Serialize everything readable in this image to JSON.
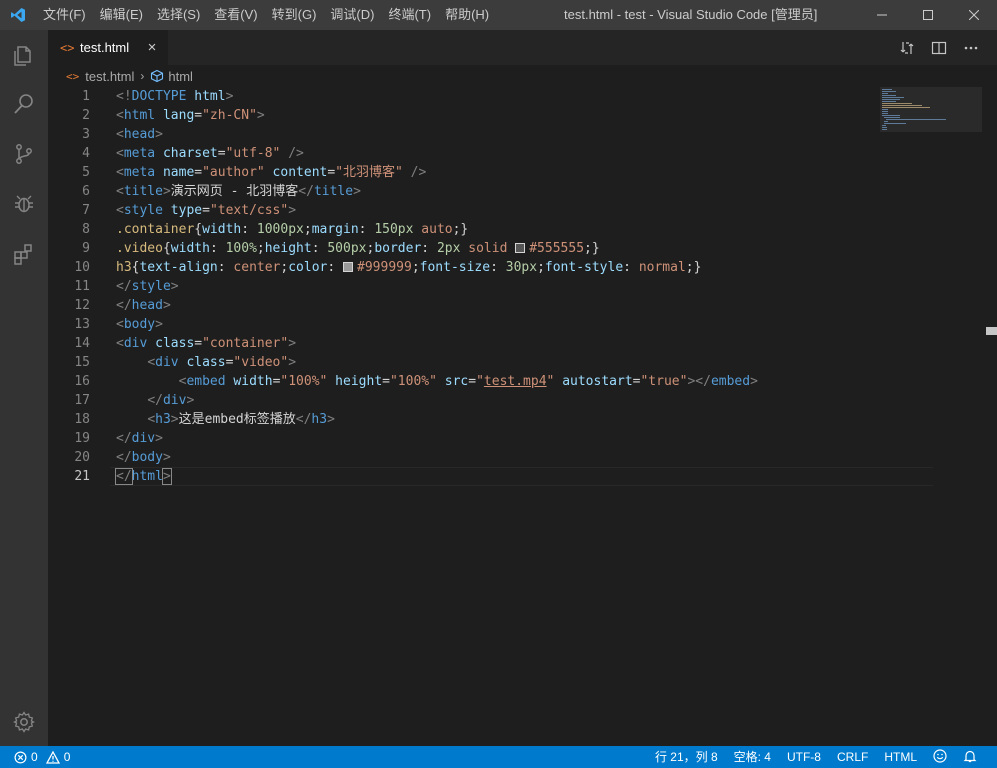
{
  "titlebar": {
    "menus": [
      "文件(F)",
      "编辑(E)",
      "选择(S)",
      "查看(V)",
      "转到(G)",
      "调试(D)",
      "终端(T)",
      "帮助(H)"
    ],
    "title": "test.html - test - Visual Studio Code [管理员]"
  },
  "activitybar": {
    "items": [
      "explorer-icon",
      "search-icon",
      "source-control-icon",
      "debug-icon",
      "extensions-icon"
    ],
    "bottom": "manage-gear-icon"
  },
  "tab": {
    "icon_text": "<>",
    "label": "test.html",
    "close": "×"
  },
  "breadcrumb": {
    "file": "test.html",
    "symbol": "html"
  },
  "line_numbers": [
    "1",
    "2",
    "3",
    "4",
    "5",
    "6",
    "7",
    "8",
    "9",
    "10",
    "11",
    "12",
    "13",
    "14",
    "15",
    "16",
    "17",
    "18",
    "19",
    "20",
    "21"
  ],
  "active_line": "21",
  "code": {
    "l1": [
      "<!",
      "DOCTYPE",
      " html",
      ">"
    ],
    "l2": [
      "<",
      "html",
      " lang",
      "=",
      "\"zh-CN\"",
      ">"
    ],
    "l3": [
      "<",
      "head",
      ">"
    ],
    "l4": [
      "<",
      "meta",
      " charset",
      "=",
      "\"utf-8\"",
      " />"
    ],
    "l5": [
      "<",
      "meta",
      " name",
      "=",
      "\"author\"",
      " content",
      "=",
      "\"北羽博客\"",
      " />"
    ],
    "l6": [
      "<",
      "title",
      ">",
      "演示网页 - 北羽博客",
      "</",
      "title",
      ">"
    ],
    "l7": [
      "<",
      "style",
      " type",
      "=",
      "\"text/css\"",
      ">"
    ],
    "l8": [
      ".container",
      "{",
      "width",
      ": ",
      "1000px",
      ";",
      "margin",
      ": ",
      "150px",
      " auto",
      ";}"
    ],
    "l9": [
      ".video",
      "{",
      "width",
      ": ",
      "100%",
      ";",
      "height",
      ": ",
      "500px",
      ";",
      "border",
      ": ",
      "2px",
      " solid ",
      "#555555",
      ";}"
    ],
    "l10": [
      "h3",
      "{",
      "text-align",
      ": ",
      "center",
      ";",
      "color",
      ": ",
      "#999999",
      ";",
      "font-size",
      ": ",
      "30px",
      ";",
      "font-style",
      ": ",
      "normal",
      ";}"
    ],
    "l11": [
      "</",
      "style",
      ">"
    ],
    "l12": [
      "</",
      "head",
      ">"
    ],
    "l13": [
      "<",
      "body",
      ">"
    ],
    "l14": [
      "<",
      "div",
      " class",
      "=",
      "\"container\"",
      ">"
    ],
    "l15": [
      "    ",
      "<",
      "div",
      " class",
      "=",
      "\"video\"",
      ">"
    ],
    "l16": [
      "        ",
      "<",
      "embed",
      " width",
      "=",
      "\"100%\"",
      " height",
      "=",
      "\"100%\"",
      " src",
      "=",
      "\"",
      "test.mp4",
      "\"",
      " autostart",
      "=",
      "\"true\"",
      "></",
      "embed",
      ">"
    ],
    "l17": [
      "    ",
      "</",
      "div",
      ">"
    ],
    "l18": [
      "    ",
      "<",
      "h3",
      ">",
      "这是embed标签播放",
      "</",
      "h3",
      ">"
    ],
    "l19": [
      "</",
      "div",
      ">"
    ],
    "l20": [
      "</",
      "body",
      ">"
    ],
    "l21": [
      "</",
      "html",
      ">"
    ]
  },
  "swatches": {
    "video_border": "#555555",
    "h3_color": "#999999"
  },
  "statusbar": {
    "errors": "0",
    "warnings": "0",
    "position": "行 21，列 8",
    "indent": "空格: 4",
    "encoding": "UTF-8",
    "eol": "CRLF",
    "language": "HTML"
  },
  "colors": {
    "titlebar": "#3c3c3c",
    "activitybar": "#333333",
    "editor": "#1e1e1e",
    "statusbar": "#007acc",
    "html_icon": "#e37933"
  }
}
